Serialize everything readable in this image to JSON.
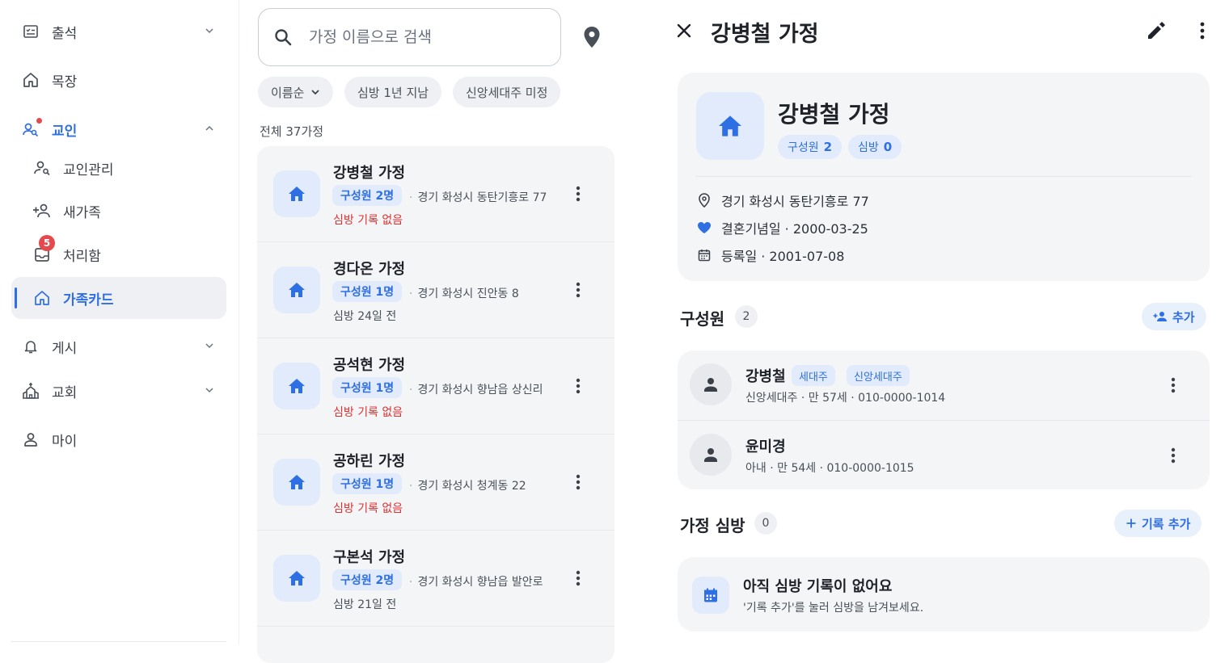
{
  "sidebar": {
    "items": [
      {
        "label": "출석",
        "icon": "attendance-icon",
        "expandable": true
      },
      {
        "label": "목장",
        "icon": "home-outline-icon"
      },
      {
        "label": "교인",
        "icon": "people-search-icon",
        "expanded": true,
        "alert_dot": true
      },
      {
        "label": "교인관리",
        "icon": "person-search-icon"
      },
      {
        "label": "새가족",
        "icon": "person-add-icon"
      },
      {
        "label": "처리함",
        "icon": "inbox-icon",
        "badge": "5"
      },
      {
        "label": "가족카드",
        "icon": "home-outline-icon",
        "selected": true
      },
      {
        "label": "게시",
        "icon": "bell-icon",
        "expandable": true
      },
      {
        "label": "교회",
        "icon": "church-icon",
        "expandable": true
      },
      {
        "label": "마이",
        "icon": "person-icon"
      }
    ]
  },
  "list": {
    "search_placeholder": "가정 이름으로 검색",
    "filters": [
      "이름순",
      "심방 1년 지남",
      "신앙세대주 미정"
    ],
    "total_label": "전체 37가정",
    "families": [
      {
        "name": "강병철 가정",
        "members": "구성원 2명",
        "address": "경기 화성시 동탄기흥로 77",
        "visit": "심방 기록 없음",
        "no_visit": true
      },
      {
        "name": "경다온 가정",
        "members": "구성원 1명",
        "address": "경기 화성시 진안동 8",
        "visit": "심방 24일 전",
        "no_visit": false
      },
      {
        "name": "공석현 가정",
        "members": "구성원 1명",
        "address": "경기 화성시 향남읍 상신리",
        "visit": "심방 기록 없음",
        "no_visit": true
      },
      {
        "name": "공하린 가정",
        "members": "구성원 1명",
        "address": "경기 화성시 청계동 22",
        "visit": "심방 기록 없음",
        "no_visit": true
      },
      {
        "name": "구본석 가정",
        "members": "구성원 2명",
        "address": "경기 화성시 향남읍 발안로",
        "visit": "심방 21일 전",
        "no_visit": false
      }
    ]
  },
  "detail": {
    "title": "강병철 가정",
    "summary": {
      "name": "강병철 가정",
      "members_label": "구성원",
      "members_value": "2",
      "visits_label": "심방",
      "visits_value": "0",
      "address": "경기 화성시 동탄기흥로 77",
      "anniversary": "결혼기념일 · 2000-03-25",
      "registered": "등록일 · 2001-07-08"
    },
    "members_section": {
      "title": "구성원",
      "count": "2",
      "add_label": "추가",
      "members": [
        {
          "name": "강병철",
          "tags": [
            "세대주",
            "신앙세대주"
          ],
          "desc": "신앙세대주 · 만 57세 · 010-0000-1014"
        },
        {
          "name": "윤미경",
          "tags": [],
          "desc": "아내 · 만 54세 · 010-0000-1015"
        }
      ]
    },
    "visits_section": {
      "title": "가정 심방",
      "count": "0",
      "add_label": "기록 추가",
      "empty_title": "아직 심방 기록이 없어요",
      "empty_desc": "'기록 추가'를 눌러 심방을 남겨보세요."
    }
  },
  "colors": {
    "accent": "#2f6fe4",
    "danger": "#e03131",
    "surface": "#f4f5f7"
  }
}
